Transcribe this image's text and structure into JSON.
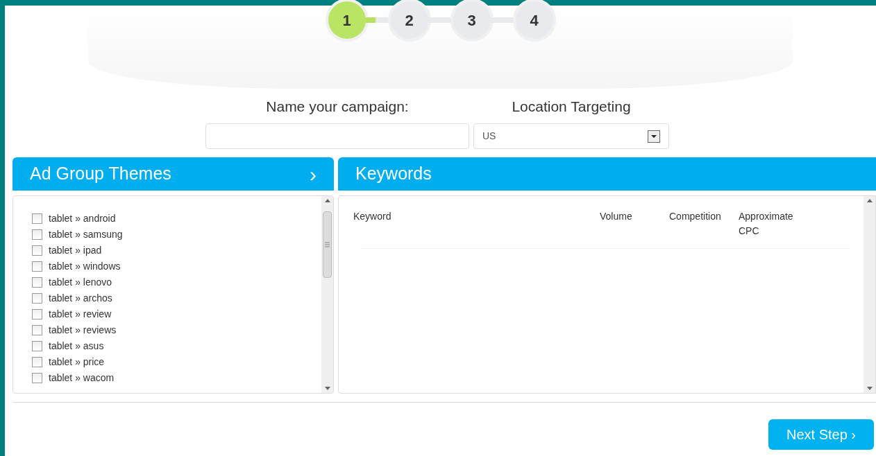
{
  "steps": [
    {
      "label": "1",
      "selected": true
    },
    {
      "label": "2",
      "selected": false
    },
    {
      "label": "3",
      "selected": false
    },
    {
      "label": "4",
      "selected": false
    }
  ],
  "campaign": {
    "label": "Name your campaign:"
  },
  "location": {
    "label": "Location Targeting",
    "value": "US"
  },
  "themes": {
    "title": "Ad Group Themes",
    "arrow": "›",
    "items": [
      {
        "label": "tablet » android",
        "checked": false
      },
      {
        "label": "tablet » samsung",
        "checked": false
      },
      {
        "label": "tablet » ipad",
        "checked": false
      },
      {
        "label": "tablet » windows",
        "checked": false
      },
      {
        "label": "tablet » lenovo",
        "checked": false
      },
      {
        "label": "tablet » archos",
        "checked": false
      },
      {
        "label": "tablet » review",
        "checked": false
      },
      {
        "label": "tablet » reviews",
        "checked": false
      },
      {
        "label": "tablet » asus",
        "checked": false
      },
      {
        "label": "tablet » price",
        "checked": false
      },
      {
        "label": "tablet » wacom",
        "checked": false
      }
    ]
  },
  "keywords": {
    "title": "Keywords",
    "columns": [
      "Keyword",
      "Volume",
      "Competition",
      "Approximate CPC"
    ]
  },
  "next_button": "Next Step ›"
}
